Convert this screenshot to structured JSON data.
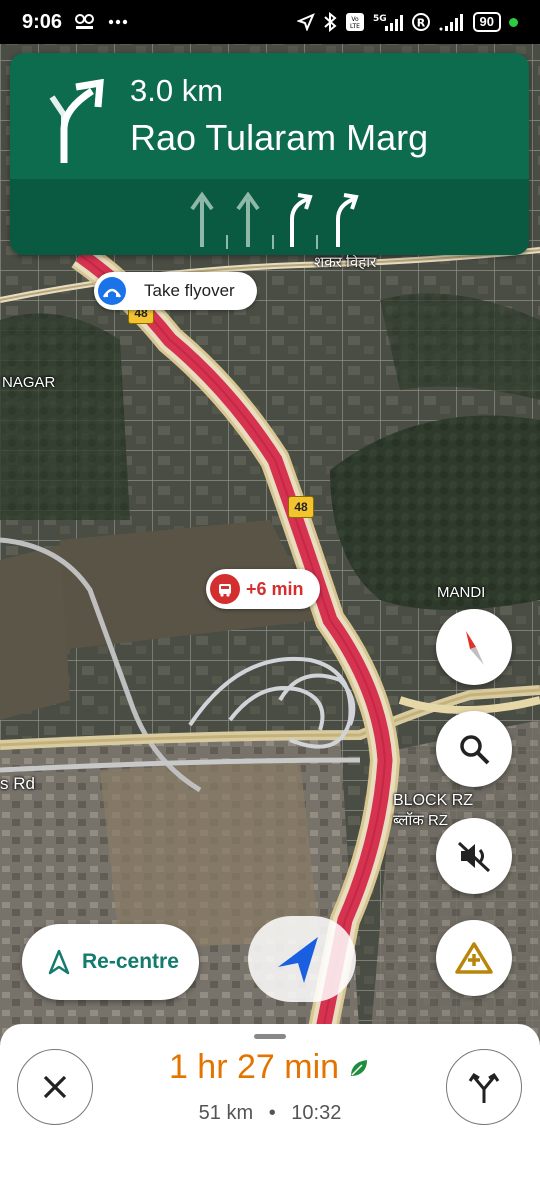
{
  "status": {
    "time": "9:06",
    "battery": "90"
  },
  "nav": {
    "distance": "3.0 km",
    "street": "Rao Tularam Marg"
  },
  "map": {
    "flyover_label": "Take flyover",
    "delay_label": "+6 min",
    "highway": "48",
    "labels": [
      "शकर विहार",
      "NAGAR",
      "MANDI",
      "s Rd",
      "BLOCK RZ",
      "ब्लॉक RZ"
    ]
  },
  "controls": {
    "recentre": "Re-centre"
  },
  "trip": {
    "duration": "1 hr 27 min",
    "distance": "51 km",
    "separator": "•",
    "arrival": "10:32"
  },
  "colors": {
    "nav_card": "#0d6b4e",
    "traffic_red": "#d63350",
    "eta_orange": "#e37400",
    "recentre_teal": "#137a6e"
  }
}
